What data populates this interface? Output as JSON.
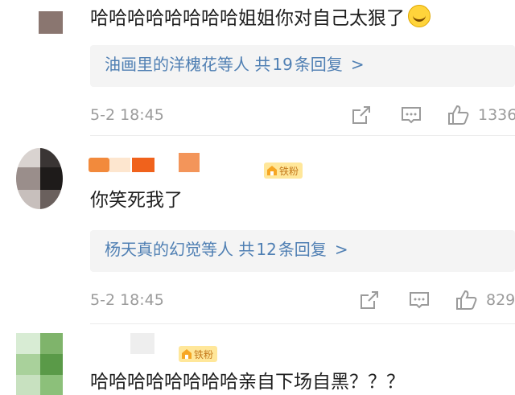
{
  "comments": [
    {
      "text": "哈哈哈哈哈哈哈哈姐姐你对自己太狠了",
      "emoji": "laughing-crying-emoji",
      "replies": {
        "names": "油画里的洋槐花等人",
        "prefix": "共",
        "count": "19",
        "suffix": "条回复",
        "chevron": ">"
      },
      "timestamp": "5-2 18:45",
      "likes": "1336"
    },
    {
      "text": "你笑死我了",
      "badge": "铁粉",
      "replies": {
        "names": "杨天真的幻觉等人",
        "prefix": "共",
        "count": "12",
        "suffix": "条回复",
        "chevron": ">"
      },
      "timestamp": "5-2 18:45",
      "likes": "829"
    },
    {
      "text": "哈哈哈哈哈哈哈哈亲自下场自黑？？？",
      "badge": "铁粉"
    }
  ],
  "colors": {
    "link": "#4f7fb3",
    "meta": "#9b9b9b",
    "reply_bg": "#f4f4f4",
    "badge_bg": "#ffe79a",
    "badge_text": "#c5791c"
  }
}
